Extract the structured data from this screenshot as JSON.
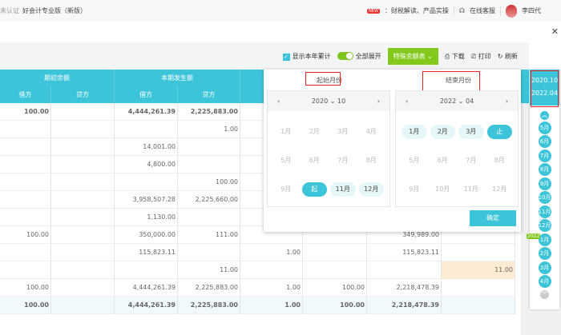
{
  "topbar": {
    "auth": "未认证",
    "app_title": "好会计专业版（新版）",
    "new_badge": "NEW",
    "news": "：财税解读、产品实操",
    "support": "在线客服",
    "user": "李四代"
  },
  "toolbar": {
    "show_year_total": "显示本年累计",
    "expand_all": "全部展开",
    "special_balance": "特殊余额表",
    "download": "下载",
    "print": "打印",
    "refresh": "刷新"
  },
  "table": {
    "group_headers": [
      "期初余额",
      "本期发生额"
    ],
    "sub_headers": [
      "借方",
      "贷方",
      "借方",
      "贷方"
    ],
    "rows": [
      [
        "100.00",
        "",
        "4,444,261.39",
        "2,225,883.00",
        "",
        "",
        "",
        "",
        ""
      ],
      [
        "",
        "",
        "",
        "1.00",
        "",
        "",
        "",
        "",
        ""
      ],
      [
        "",
        "",
        "14,001.00",
        "",
        "",
        "",
        "",
        "",
        ""
      ],
      [
        "",
        "",
        "4,800.00",
        "",
        "",
        "",
        "",
        "",
        ""
      ],
      [
        "",
        "",
        "",
        "100.00",
        "",
        "",
        "",
        "",
        ""
      ],
      [
        "",
        "",
        "3,958,507.28",
        "2,225,660.00",
        "",
        "",
        "",
        "",
        ""
      ],
      [
        "",
        "",
        "1,130.00",
        "",
        "",
        "",
        "",
        "",
        ""
      ],
      [
        "100.00",
        "",
        "350,000.00",
        "111.00",
        "",
        "",
        "349,989.00",
        ""
      ],
      [
        "",
        "",
        "115,823.11",
        "",
        "1.00",
        "",
        "115,823.11",
        ""
      ],
      [
        "",
        "",
        "",
        "11.00",
        "",
        "",
        "",
        "11.00"
      ],
      [
        "100.00",
        "",
        "4,444,261.39",
        "2,225,883.00",
        "1.00",
        "100.00",
        "2,218,478.39",
        ""
      ]
    ],
    "total": [
      "100.00",
      "",
      "4,444,261.39",
      "2,225,883.00",
      "1.00",
      "100.00",
      "2,218,478.39",
      ""
    ]
  },
  "picker": {
    "start_title": "起始月份",
    "end_title": "结束月份",
    "start": {
      "year": "2020",
      "month": "10",
      "months": [
        "1月",
        "2月",
        "3月",
        "4月",
        "5月",
        "6月",
        "7月",
        "8月",
        "9月",
        "起",
        "11月",
        "12月"
      ]
    },
    "end": {
      "year": "2022",
      "month": "04",
      "months": [
        "1月",
        "2月",
        "3月",
        "止",
        "5月",
        "6月",
        "7月",
        "8月",
        "9月",
        "10月",
        "11月",
        "12月"
      ]
    },
    "confirm": "确定"
  },
  "sidebar": {
    "range_start": "2020.10",
    "range_sep": "-",
    "range_end": "2022.04",
    "year_badge": "2022",
    "months": [
      "5月",
      "6月",
      "7月",
      "8月",
      "9月",
      "10月",
      "11月",
      "12月",
      "1月",
      "2月",
      "3月",
      "4月"
    ]
  },
  "colors": {
    "accent": "#3cc4d9",
    "green": "#83c91b",
    "highlight": "#fdebd3",
    "annotation": "#e22222"
  }
}
